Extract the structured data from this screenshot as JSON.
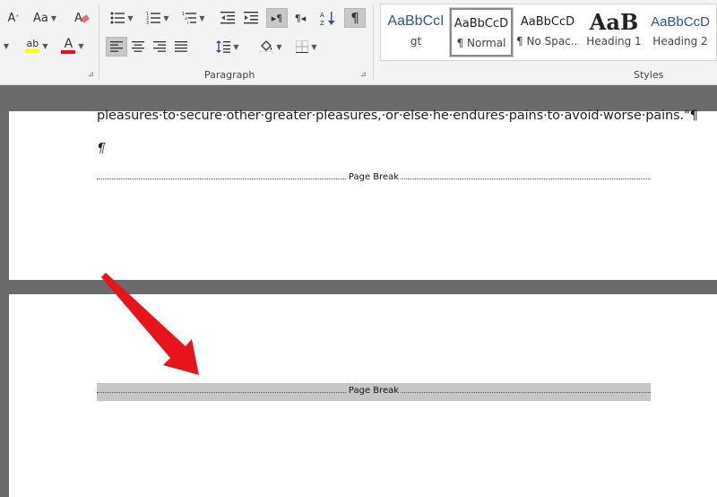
{
  "ribbon": {
    "paragraph_label": "Paragraph",
    "styles_label": "Styles",
    "font": {
      "grow_font": "A",
      "change_case": "Aa",
      "highlight_letters": "ab",
      "font_color_letter": "A"
    },
    "paragraph": {
      "show_marks_symbol": "¶",
      "ltr_symbol": "¶",
      "rtl_symbol": "¶"
    },
    "styles": [
      {
        "preview": "AaBbCcI",
        "name": "gt",
        "color": "#2f5496"
      },
      {
        "preview": "AaBbCcD",
        "name": "¶ Normal",
        "color": "#222222",
        "selected": true
      },
      {
        "preview": "AaBbCcD",
        "name": "¶ No Spac...",
        "color": "#222222"
      },
      {
        "preview": "AaB",
        "name": "Heading 1",
        "color": "#222222"
      },
      {
        "preview": "AaBbCcD",
        "name": "Heading 2",
        "color": "#2f5496"
      }
    ],
    "colors": {
      "highlight": "#ffff00",
      "font_color": "#e81123"
    }
  },
  "document": {
    "page1_text": "pleasures·to·secure·other·greater·pleasures,·or·else·he·endures·pains·to·avoid·worse·pains.\"¶",
    "page1_pilcrow": "¶",
    "page_break_label": "Page Break",
    "page2_break_label": "Page Break"
  },
  "annotation": {
    "arrow_color": "#e8141b"
  }
}
